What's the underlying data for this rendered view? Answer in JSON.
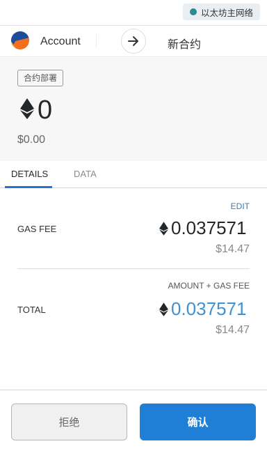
{
  "network": {
    "label": "以太坊主网络"
  },
  "account": {
    "name": "Account"
  },
  "destination": {
    "label": "新合约"
  },
  "summary": {
    "action_badge": "合约部署",
    "amount": "0",
    "fiat": "$0.00"
  },
  "tabs": [
    {
      "label": "DETAILS",
      "active": true
    },
    {
      "label": "DATA",
      "active": false
    }
  ],
  "details": {
    "edit_label": "EDIT",
    "gas_fee": {
      "label": "GAS FEE",
      "eth": "0.037571",
      "fiat": "$14.47"
    },
    "total": {
      "caption": "AMOUNT + GAS FEE",
      "label": "TOTAL",
      "eth": "0.037571",
      "fiat": "$14.47"
    }
  },
  "footer": {
    "reject_label": "拒绝",
    "confirm_label": "确认"
  },
  "colors": {
    "accent": "#1f7ed6",
    "total_amount": "#3d92d4",
    "link": "#3a7bb6"
  },
  "icons": {
    "network": "network-status-dot",
    "currency": "ethereum-icon",
    "arrow": "arrow-right-icon"
  }
}
